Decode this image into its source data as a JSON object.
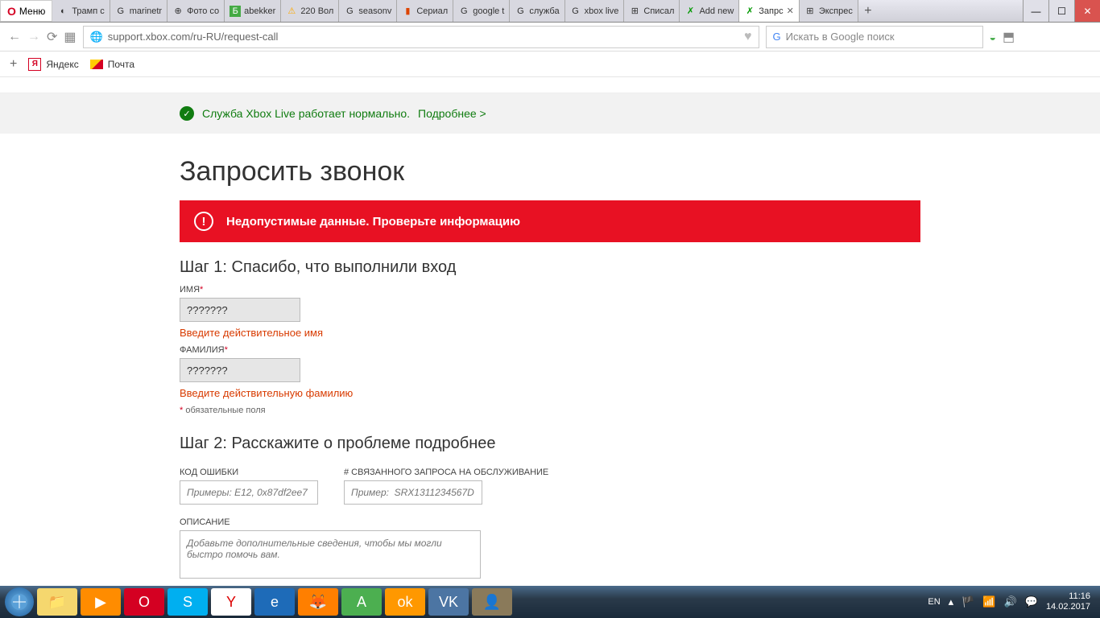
{
  "chrome": {
    "menu": "Меню",
    "tabs": [
      {
        "label": "Трамп с",
        "fav": "◐"
      },
      {
        "label": "marinetr",
        "fav": "G"
      },
      {
        "label": "Фото со",
        "fav": "⊕"
      },
      {
        "label": "abekker",
        "fav": "Б"
      },
      {
        "label": "220 Вол",
        "fav": "⚠"
      },
      {
        "label": "seasonv",
        "fav": "G"
      },
      {
        "label": "Сериал",
        "fav": "▮"
      },
      {
        "label": "google t",
        "fav": "G"
      },
      {
        "label": "служба",
        "fav": "G"
      },
      {
        "label": "xbox live",
        "fav": "G"
      },
      {
        "label": "Списал",
        "fav": "⊞"
      },
      {
        "label": "Add new",
        "fav": "✗"
      },
      {
        "label": "Запрс",
        "fav": "✗",
        "active": true
      },
      {
        "label": "Экспрес",
        "fav": "⊞"
      }
    ],
    "win_min": "—",
    "win_max": "☐",
    "win_close": "✕"
  },
  "addr": {
    "url": "support.xbox.com/ru-RU/request-call",
    "search_placeholder": "Искать в Google поиск"
  },
  "bookmarks": {
    "yandex": "Яндекс",
    "mail": "Почта"
  },
  "status": {
    "text": "Служба Xbox Live работает нормально.",
    "link": "Подробнее >"
  },
  "page_title": "Запросить звонок",
  "alert": "Недопустимые данные. Проверьте информацию",
  "step1": {
    "title": "Шаг 1:  Спасибо, что выполнили вход",
    "name_label": "ИМЯ",
    "name_value": "???????",
    "name_error": "Введите действительное имя",
    "surname_label": "ФАМИЛИЯ",
    "surname_value": "???????",
    "surname_error": "Введите действительную фамилию",
    "req_note": "обязательные поля"
  },
  "step2": {
    "title": "Шаг 2:  Расскажите о проблеме подробнее",
    "code_label": "КОД ОШИБКИ",
    "code_placeholder": "Примеры: E12, 0x87df2ee7",
    "sr_label": "# СВЯЗАННОГО ЗАПРОСА НА ОБСЛУЖИВАНИЕ",
    "sr_placeholder": "Пример:  SRX1311234567D",
    "desc_label": "ОПИСАНИЕ",
    "desc_placeholder": "Добавьте дополнительные сведения, чтобы мы могли быстро помочь вам."
  },
  "tray": {
    "lang": "EN",
    "time": "11:16",
    "date": "14.02.2017"
  }
}
